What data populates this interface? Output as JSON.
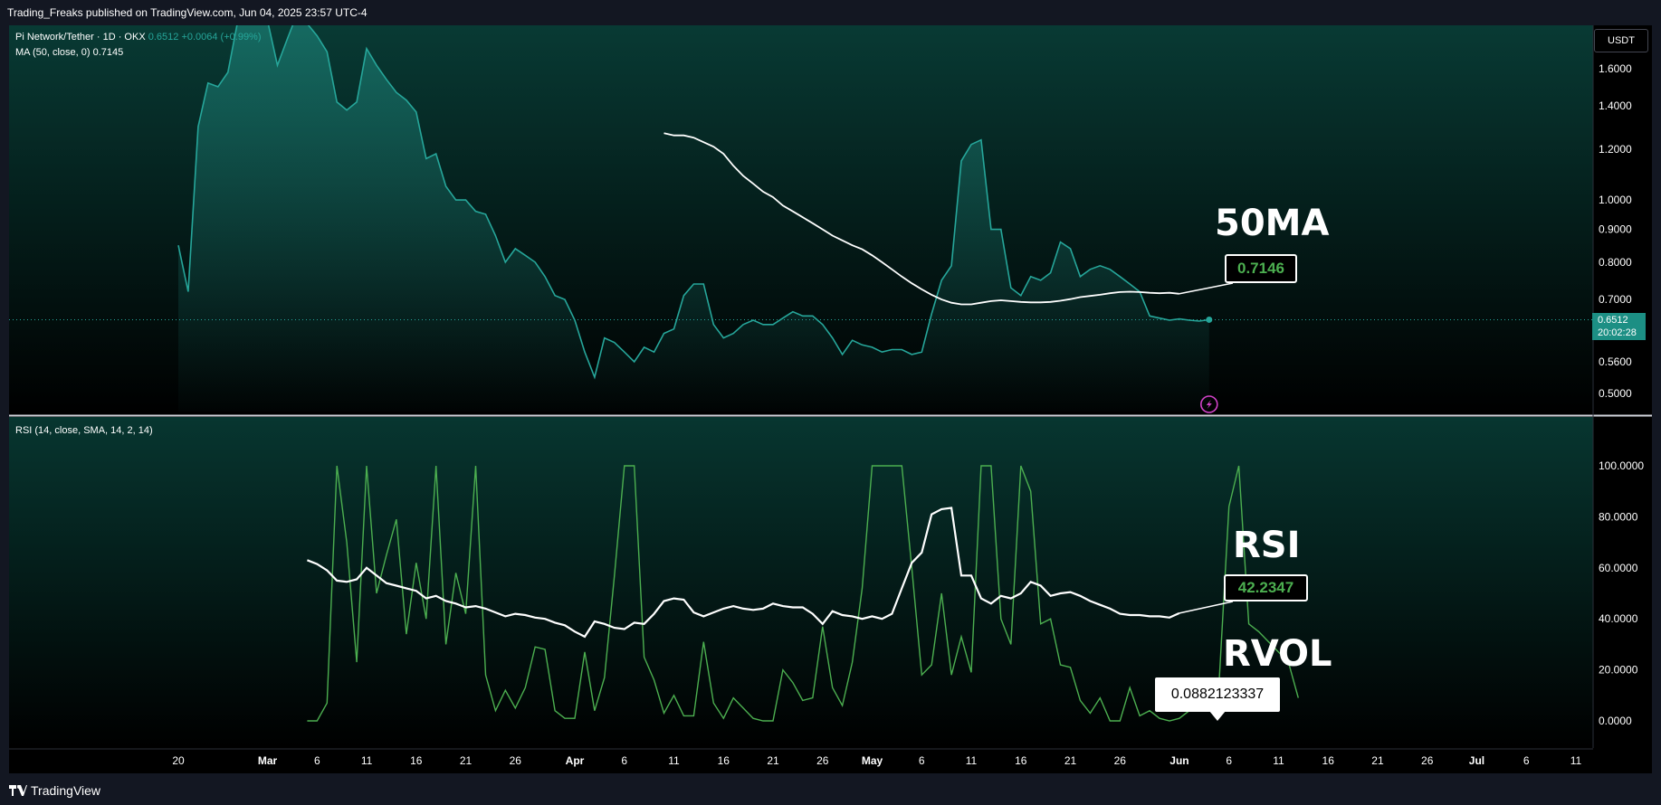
{
  "header": {
    "published": "Trading_Freaks published on TradingView.com, Jun 04, 2025 23:57 UTC-4"
  },
  "main_legend": {
    "symbol": "Pi Network/Tether · 1D · OKX",
    "price": "0.6512",
    "change": "+0.0064 (+0.99%)",
    "ma_label": "MA (50, close, 0)",
    "ma_value": "0.7145"
  },
  "rsi_legend": {
    "label": "RSI (14, close, SMA, 14, 2, 14)"
  },
  "currency": "USDT",
  "last_price_tag": {
    "price": "0.6512",
    "countdown": "20:02:28"
  },
  "annotations": {
    "ma_title": "50MA",
    "ma_value": "0.7146",
    "rsi_title": "RSI",
    "rsi_value": "42.2347",
    "rvol_title": "RVOL",
    "rvol_value": "0.0882123337"
  },
  "brand": "TradingView",
  "colors": {
    "price": "#26a69a",
    "ma": "#ffffff",
    "rsi": "#ffffff",
    "rvol": "#4caf50",
    "accent": "#1c8f84"
  },
  "chart_data": [
    {
      "type": "area",
      "title": "Pi Network/Tether · 1D · OKX",
      "y_scale": "log",
      "ylim": [
        0.46,
        1.8
      ],
      "y_ticks": [
        1.6,
        1.4,
        1.2,
        1.0,
        0.9,
        0.8,
        0.7,
        0.56,
        0.5
      ],
      "y_tick_labels": [
        "1.6000",
        "1.4000",
        "1.2000",
        "1.0000",
        "0.9000",
        "0.8000",
        "0.7000",
        "0.5600",
        "0.5000"
      ],
      "x_tick_labels": [
        "20",
        "Mar",
        "6",
        "11",
        "16",
        "21",
        "26",
        "Apr",
        "6",
        "11",
        "16",
        "21",
        "26",
        "May",
        "6",
        "11",
        "16",
        "21",
        "26",
        "Jun",
        "6",
        "11",
        "16",
        "21",
        "26",
        "Jul",
        "6",
        "11"
      ],
      "x_start": "2025-02-20",
      "series": [
        {
          "name": "Pi Network/Tether",
          "values": [
            0.85,
            0.72,
            1.3,
            1.52,
            1.5,
            1.58,
            1.9,
            1.9,
            1.88,
            1.9,
            1.62,
            1.78,
            1.95,
            1.88,
            1.8,
            1.7,
            1.42,
            1.38,
            1.42,
            1.72,
            1.62,
            1.54,
            1.47,
            1.43,
            1.37,
            1.16,
            1.18,
            1.05,
            1.0,
            1.0,
            0.96,
            0.95,
            0.88,
            0.8,
            0.84,
            0.82,
            0.8,
            0.76,
            0.71,
            0.7,
            0.65,
            0.58,
            0.53,
            0.61,
            0.6,
            0.58,
            0.56,
            0.59,
            0.58,
            0.62,
            0.63,
            0.71,
            0.74,
            0.74,
            0.64,
            0.61,
            0.62,
            0.64,
            0.65,
            0.64,
            0.64,
            0.655,
            0.67,
            0.66,
            0.66,
            0.64,
            0.61,
            0.575,
            0.605,
            0.595,
            0.59,
            0.58,
            0.585,
            0.585,
            0.575,
            0.58,
            0.665,
            0.75,
            0.79,
            1.15,
            1.22,
            1.24,
            0.9,
            0.9,
            0.73,
            0.71,
            0.76,
            0.75,
            0.77,
            0.86,
            0.84,
            0.76,
            0.78,
            0.79,
            0.78,
            0.76,
            0.74,
            0.72,
            0.66,
            0.655,
            0.65,
            0.653,
            0.65,
            0.648,
            0.6512
          ]
        },
        {
          "name": "MA (50, close, 0)",
          "start": "2025-04-10",
          "values": [
            1.27,
            1.26,
            1.26,
            1.25,
            1.23,
            1.21,
            1.18,
            1.13,
            1.09,
            1.06,
            1.03,
            1.01,
            0.98,
            0.96,
            0.94,
            0.92,
            0.9,
            0.88,
            0.865,
            0.85,
            0.838,
            0.82,
            0.8,
            0.78,
            0.76,
            0.742,
            0.726,
            0.712,
            0.7,
            0.692,
            0.688,
            0.688,
            0.692,
            0.696,
            0.698,
            0.696,
            0.694,
            0.693,
            0.693,
            0.694,
            0.697,
            0.701,
            0.706,
            0.709,
            0.712,
            0.716,
            0.719,
            0.72,
            0.719,
            0.717,
            0.716,
            0.717,
            0.7146
          ]
        }
      ]
    },
    {
      "type": "line",
      "title": "RSI (14, close, SMA, 14, 2, 14)",
      "ylim": [
        -10,
        112
      ],
      "y_ticks": [
        100,
        80,
        60,
        40,
        20,
        0
      ],
      "y_tick_labels": [
        "100.0000",
        "80.0000",
        "60.0000",
        "40.0000",
        "20.0000",
        "0.0000"
      ],
      "x_start": "2025-03-05",
      "series": [
        {
          "name": "RSI",
          "values": [
            63,
            61.5,
            59,
            55,
            54.5,
            55.5,
            60,
            57,
            54,
            53,
            52,
            51,
            48,
            49,
            47,
            46,
            44.5,
            45,
            44,
            42.5,
            41,
            42,
            41.5,
            40.5,
            40,
            38.5,
            37.5,
            35,
            33,
            39,
            38,
            36.5,
            36,
            38.5,
            38,
            42,
            47,
            48,
            47.5,
            42.5,
            41,
            42.5,
            44,
            45,
            44,
            43.5,
            44,
            46,
            45,
            44.5,
            44.5,
            42,
            38,
            43,
            41.5,
            41,
            40,
            41,
            40,
            42,
            52,
            62,
            66,
            81,
            83,
            83.5,
            57,
            57,
            48,
            46,
            49,
            48,
            50,
            54.5,
            53,
            49,
            50,
            50.5,
            49,
            47,
            45.5,
            44,
            42,
            41.5,
            41.5,
            41,
            41,
            40.5,
            42.2347
          ]
        },
        {
          "name": "RVOL",
          "values": [
            0,
            0,
            7,
            100,
            70,
            23,
            100,
            50,
            65,
            79,
            34,
            62,
            40,
            100,
            30,
            58,
            42,
            100,
            18,
            4,
            12,
            5,
            13,
            29,
            28,
            4,
            1,
            1,
            27,
            4,
            17,
            57,
            100,
            100,
            25,
            16,
            3,
            10,
            2,
            2,
            31,
            7,
            1,
            9,
            5,
            1,
            0,
            0,
            20,
            15,
            8,
            9,
            37,
            13,
            6,
            23,
            52,
            100,
            100,
            100,
            100,
            60,
            18,
            22,
            50,
            18,
            33,
            19,
            100,
            100,
            40,
            30,
            100,
            90,
            38,
            40,
            22,
            21,
            8,
            3,
            9,
            0,
            0,
            13,
            2,
            4,
            1,
            0,
            1,
            4,
            9,
            8,
            15,
            84,
            100,
            38,
            35,
            31,
            27,
            23,
            9
          ]
        }
      ]
    }
  ]
}
